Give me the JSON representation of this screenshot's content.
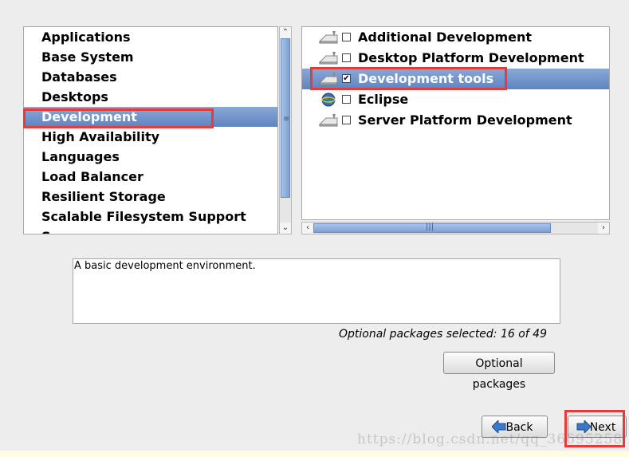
{
  "groups": {
    "items": [
      {
        "label": "Applications"
      },
      {
        "label": "Base System"
      },
      {
        "label": "Databases"
      },
      {
        "label": "Desktops"
      },
      {
        "label": "Development",
        "selected": true
      },
      {
        "label": "High Availability"
      },
      {
        "label": "Languages"
      },
      {
        "label": "Load Balancer"
      },
      {
        "label": "Resilient Storage"
      },
      {
        "label": "Scalable Filesystem Support"
      },
      {
        "label": "S"
      }
    ]
  },
  "packages": {
    "items": [
      {
        "label": "Additional Development",
        "checked": false,
        "icon": "hard-drive-icon"
      },
      {
        "label": "Desktop Platform Development",
        "checked": false,
        "icon": "hard-drive-icon"
      },
      {
        "label": "Development tools",
        "checked": true,
        "selected": true,
        "icon": "hard-drive-icon"
      },
      {
        "label": "Eclipse",
        "checked": false,
        "icon": "eclipse-globe-icon"
      },
      {
        "label": "Server Platform Development",
        "checked": false,
        "icon": "hard-drive-icon"
      }
    ]
  },
  "description": "A basic development environment.",
  "optional_status": "Optional packages selected: 16 of 49",
  "buttons": {
    "optional_packages": "Optional packages",
    "back": "Back",
    "next": "Next"
  },
  "watermark": "https://blog.csdn.net/qq_36695258",
  "colors": {
    "selection": "#6f91c9",
    "highlight_box": "#e53b3b",
    "background": "#ededed"
  }
}
